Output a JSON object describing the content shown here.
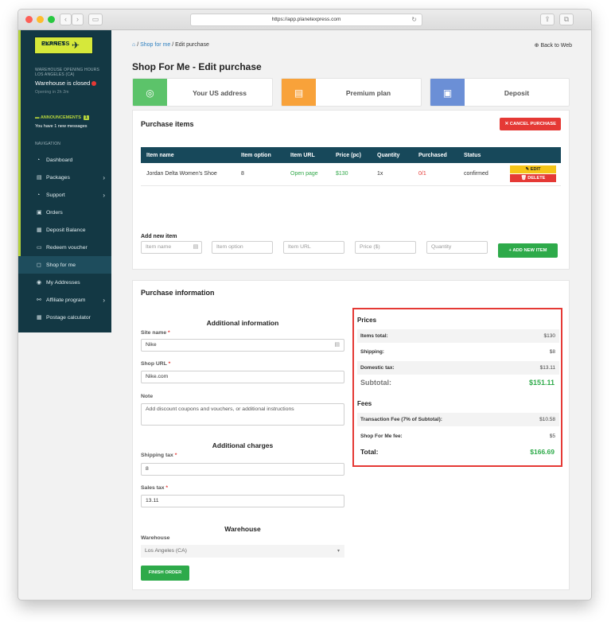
{
  "browser": {
    "url": "https://app.planetexpress.com"
  },
  "sidebar": {
    "logo_line1": "PLANET",
    "logo_line2": "EXPRESS",
    "hours_title": "WAREHOUSE OPENING HOURS",
    "hours_location": "LOS ANGELES (CA)",
    "status": "Warehouse is closed",
    "opening_in": "Opening in 2h 2m",
    "announcements_label": "ANNOUNCEMENTS",
    "announcements_count": "1",
    "messages_text": "You have 1 new messages",
    "nav_label": "NAVIGATION",
    "items": [
      {
        "label": "Dashboard",
        "icon": "dashboard-icon",
        "chevron": false
      },
      {
        "label": "Packages",
        "icon": "package-icon",
        "chevron": true
      },
      {
        "label": "Support",
        "icon": "support-icon",
        "chevron": true
      },
      {
        "label": "Orders",
        "icon": "orders-icon",
        "chevron": false
      },
      {
        "label": "Deposit Balance",
        "icon": "deposit-icon",
        "chevron": false
      },
      {
        "label": "Redeem voucher",
        "icon": "voucher-icon",
        "chevron": false
      },
      {
        "label": "Shop for me",
        "icon": "bag-icon",
        "chevron": false,
        "active": true
      },
      {
        "label": "My Addresses",
        "icon": "location-icon",
        "chevron": false
      },
      {
        "label": "Affiliate program",
        "icon": "affiliate-icon",
        "chevron": true
      },
      {
        "label": "Postage calculator",
        "icon": "calculator-icon",
        "chevron": false
      }
    ]
  },
  "header": {
    "breadcrumb_link": "Shop for me",
    "breadcrumb_current": "Edit purchase",
    "sep": "/",
    "back": "Back to Web",
    "title": "Shop For Me - Edit purchase"
  },
  "cards": [
    {
      "label": "Your US address",
      "color": "#5cc36a",
      "icon": "location-icon"
    },
    {
      "label": "Premium plan",
      "color": "#f8a23a",
      "icon": "clipboard-icon"
    },
    {
      "label": "Deposit",
      "color": "#6b8fd6",
      "icon": "deposit-icon"
    }
  ],
  "purchase_items": {
    "title": "Purchase items",
    "cancel_label": "CANCEL PURCHASE",
    "columns": [
      "Item name",
      "Item option",
      "Item URL",
      "Price (pc)",
      "Quantity",
      "Purchased",
      "Status"
    ],
    "rows": [
      {
        "name": "Jordan Delta Women's Shoe",
        "option": "8",
        "url_label": "Open page",
        "price": "$130",
        "quantity": "1x",
        "purchased": "0/1",
        "status": "confirmed",
        "edit": "EDIT",
        "delete": "DELETE"
      }
    ],
    "add_label": "Add new item",
    "placeholders": {
      "name": "Item name",
      "option": "Item option",
      "url": "Item URL",
      "price": "Price ($)",
      "quantity": "Quantity"
    },
    "add_button": "ADD NEW ITEM"
  },
  "purchase_info": {
    "title": "Purchase information",
    "additional_info_heading": "Additional information",
    "site_name_label": "Site name",
    "site_name_value": "Nike",
    "shop_url_label": "Shop URL",
    "shop_url_value": "Nike.com",
    "note_label": "Note",
    "note_placeholder": "Add discount coupons and vouchers, or additional instructions",
    "charges_heading": "Additional charges",
    "shipping_tax_label": "Shipping tax",
    "shipping_tax_value": "8",
    "sales_tax_label": "Sales tax",
    "sales_tax_value": "13.11",
    "warehouse_heading": "Warehouse",
    "warehouse_label": "Warehouse",
    "warehouse_value": "Los Angeles (CA)",
    "finish_button": "FINISH ORDER",
    "required_mark": "*"
  },
  "prices": {
    "heading": "Prices",
    "items_total_label": "Items total:",
    "items_total_value": "$130",
    "shipping_label": "Shipping:",
    "shipping_value": "$8",
    "domestic_tax_label": "Domestic tax:",
    "domestic_tax_value": "$13.11",
    "subtotal_label": "Subtotal:",
    "subtotal_value": "$151.11",
    "fees_heading": "Fees",
    "transaction_fee_label": "Transaction Fee (7% of Subtotal):",
    "transaction_fee_value": "$10.58",
    "shop_fee_label": "Shop For Me fee:",
    "shop_fee_value": "$5",
    "total_label": "Total:",
    "total_value": "$166.69"
  }
}
